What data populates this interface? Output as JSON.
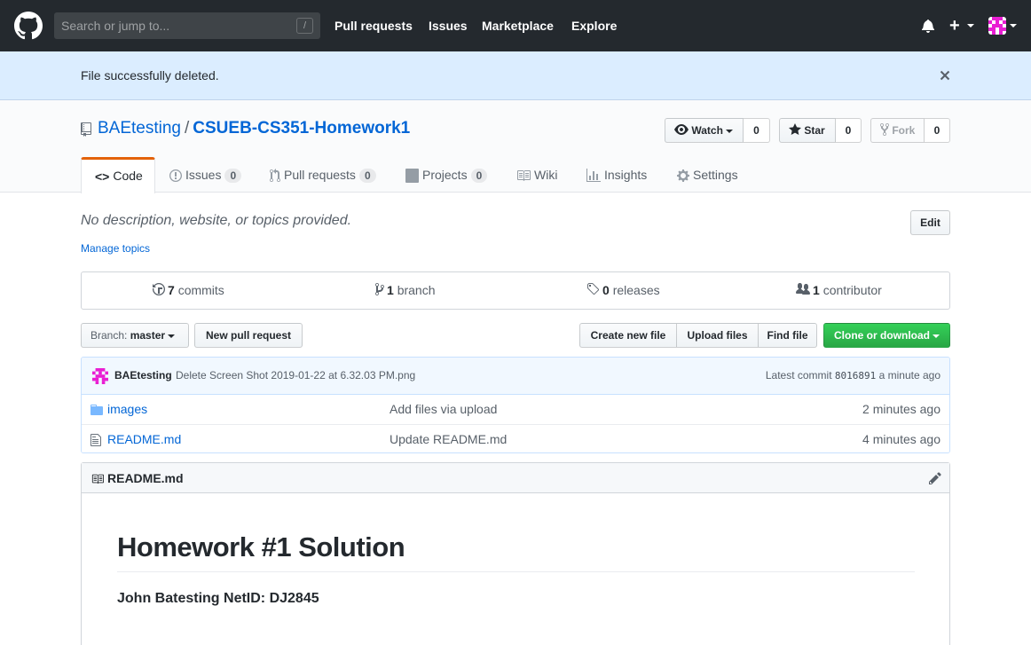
{
  "header": {
    "search_placeholder": "Search or jump to...",
    "search_shortcut": "/",
    "nav": [
      "Pull requests",
      "Issues",
      "Marketplace",
      "Explore"
    ]
  },
  "flash": {
    "message": "File successfully deleted."
  },
  "repo": {
    "owner": "BAEtesting",
    "separator": "/",
    "name": "CSUEB-CS351-Homework1",
    "watch_label": "Watch",
    "watch_count": "0",
    "star_label": "Star",
    "star_count": "0",
    "fork_label": "Fork",
    "fork_count": "0"
  },
  "tabs": [
    {
      "label": "Code",
      "icon": "code-icon"
    },
    {
      "label": "Issues",
      "count": "0",
      "icon": "issue-icon"
    },
    {
      "label": "Pull requests",
      "count": "0",
      "icon": "pull-request-icon"
    },
    {
      "label": "Projects",
      "count": "0",
      "icon": "project-icon"
    },
    {
      "label": "Wiki",
      "icon": "book-icon"
    },
    {
      "label": "Insights",
      "icon": "graph-icon"
    },
    {
      "label": "Settings",
      "icon": "gear-icon"
    }
  ],
  "description": {
    "text": "No description, website, or topics provided.",
    "edit_label": "Edit",
    "manage_topics": "Manage topics"
  },
  "summary": {
    "commits_num": "7",
    "commits_label": "commits",
    "branch_num": "1",
    "branch_label": "branch",
    "releases_num": "0",
    "releases_label": "releases",
    "contributor_num": "1",
    "contributor_label": "contributor"
  },
  "file_nav": {
    "branch_prefix": "Branch:",
    "branch_name": "master",
    "new_pr": "New pull request",
    "create_file": "Create new file",
    "upload_files": "Upload files",
    "find_file": "Find file",
    "clone": "Clone or download"
  },
  "latest_commit": {
    "author": "BAEtesting",
    "message": "Delete Screen Shot 2019-01-22 at 6.32.03 PM.png",
    "label": "Latest commit",
    "sha": "8016891",
    "age": "a minute ago"
  },
  "files": [
    {
      "type": "folder",
      "icon": "folder-icon",
      "name": "images",
      "message": "Add files via upload",
      "age": "2 minutes ago"
    },
    {
      "type": "file",
      "icon": "file-icon",
      "name": "README.md",
      "message": "Update README.md",
      "age": "4 minutes ago"
    }
  ],
  "readme": {
    "filename": "README.md",
    "heading": "Homework #1 Solution",
    "line": "John Batesting NetID: DJ2845"
  },
  "colors": {
    "header_bg": "#24292e",
    "flash_bg": "#dbedff",
    "link": "#0366d6",
    "tab_accent": "#e36209",
    "clone_green": "#28a745",
    "avatar_magenta": "#e91ed3"
  }
}
